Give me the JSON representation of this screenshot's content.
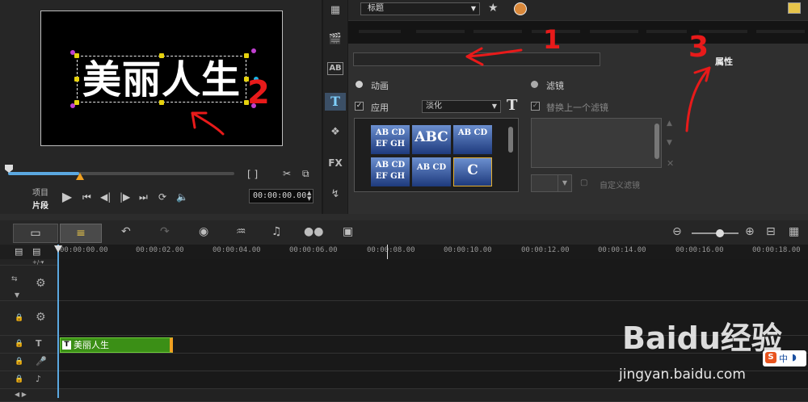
{
  "preview": {
    "caption": "美丽人生",
    "project_label": "项目",
    "clip_label": "片段",
    "timecode": "00:00:00.00"
  },
  "library": {
    "category": "标题",
    "properties_tab": "属性",
    "animation_label": "动画",
    "apply_label": "应用",
    "animation_type": "淡化",
    "filter_label": "滤镜",
    "replace_filter_label": "替换上一个滤镜",
    "custom_filter_label": "自定义滤镜",
    "presets": [
      {
        "text": "AB CD EF GH"
      },
      {
        "text": "ABC"
      },
      {
        "text": "AB CD"
      },
      {
        "text": "AB CD EF GH"
      },
      {
        "text": "AB CD"
      },
      {
        "text": "C"
      }
    ]
  },
  "timeline": {
    "ruler": [
      "00:00:00.00",
      "00:00:02.00",
      "00:00:04.00",
      "00:00:06.00",
      "00:00:08.00",
      "00:00:10.00",
      "00:00:12.00",
      "00:00:14.00",
      "00:00:16.00",
      "00:00:18.00"
    ],
    "title_clip": "美丽人生"
  },
  "annotations": [
    "1",
    "2",
    "3"
  ],
  "watermark": {
    "logo": "Baidu经验",
    "url": "jingyan.baidu.com",
    "badge": "中"
  },
  "colors": {
    "accent": "#5ba8e0",
    "clip": "#3b8f16",
    "annotation": "#e81a1a"
  }
}
